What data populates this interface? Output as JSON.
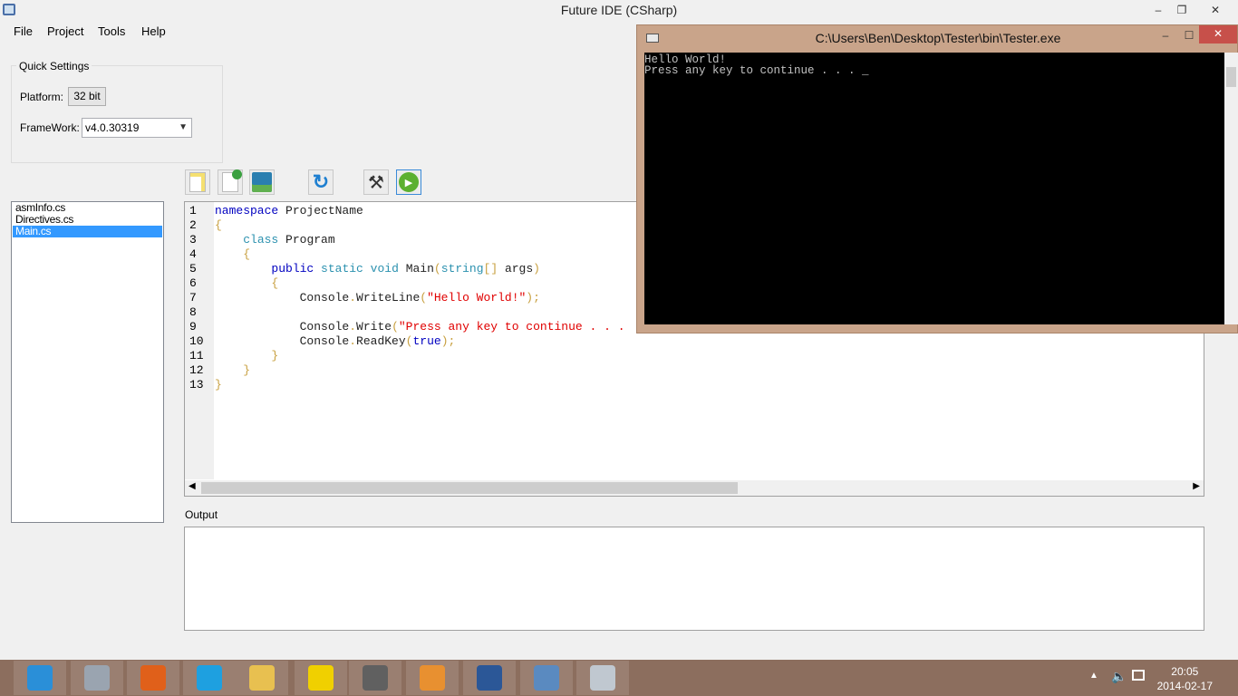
{
  "window": {
    "title": "Future IDE (CSharp)",
    "minimize": "–",
    "restore": "❐",
    "close": "✕"
  },
  "menu": [
    "File",
    "Project",
    "Tools",
    "Help"
  ],
  "quick_settings": {
    "title": "Quick Settings",
    "platform_label": "Platform:",
    "platform_value": "32 bit",
    "framework_label": "FrameWork:",
    "framework_value": "v4.0.30319"
  },
  "toolbar": [
    "new-file-icon",
    "add-file-icon",
    "save-icon",
    "refresh-icon",
    "build-tools-icon",
    "run-icon"
  ],
  "files": [
    {
      "name": "asmInfo.cs",
      "selected": false
    },
    {
      "name": "Directives.cs",
      "selected": false
    },
    {
      "name": "Main.cs",
      "selected": true
    }
  ],
  "editor": {
    "line_numbers": [
      "1",
      "2",
      "3",
      "4",
      "5",
      "6",
      "7",
      "8",
      "9",
      "10",
      "11",
      "12",
      "13"
    ],
    "lines": [
      [
        [
          "kw",
          "namespace"
        ],
        [
          "id",
          " ProjectName"
        ]
      ],
      [
        [
          "pu",
          "{"
        ]
      ],
      [
        [
          "id",
          "    "
        ],
        [
          "ty",
          "class"
        ],
        [
          "id",
          " Program"
        ]
      ],
      [
        [
          "pu",
          "    {"
        ]
      ],
      [
        [
          "id",
          "        "
        ],
        [
          "kw",
          "public"
        ],
        [
          "id",
          " "
        ],
        [
          "ty",
          "static"
        ],
        [
          "id",
          " "
        ],
        [
          "ty",
          "void"
        ],
        [
          "id",
          " Main"
        ],
        [
          "pu",
          "("
        ],
        [
          "ty",
          "string"
        ],
        [
          "pu",
          "[]"
        ],
        [
          "id",
          " args"
        ],
        [
          "pu",
          ")"
        ]
      ],
      [
        [
          "pu",
          "        {"
        ]
      ],
      [
        [
          "id",
          "            Console"
        ],
        [
          "pu",
          "."
        ],
        [
          "id",
          "WriteLine"
        ],
        [
          "pu",
          "("
        ],
        [
          "st",
          "\"Hello World!\""
        ],
        [
          "pu",
          ");"
        ]
      ],
      [],
      [
        [
          "id",
          "            Console"
        ],
        [
          "pu",
          "."
        ],
        [
          "id",
          "Write"
        ],
        [
          "pu",
          "("
        ],
        [
          "st",
          "\"Press any key to continue . . ."
        ]
      ],
      [
        [
          "id",
          "            Console"
        ],
        [
          "pu",
          "."
        ],
        [
          "id",
          "ReadKey"
        ],
        [
          "pu",
          "("
        ],
        [
          "kw",
          "true"
        ],
        [
          "pu",
          ");"
        ]
      ],
      [
        [
          "pu",
          "        }"
        ]
      ],
      [
        [
          "pu",
          "    }"
        ]
      ],
      [
        [
          "pu",
          "}"
        ]
      ]
    ]
  },
  "output": {
    "label": "Output"
  },
  "console": {
    "title": "C:\\Users\\Ben\\Desktop\\Tester\\bin\\Tester.exe",
    "lines": [
      "Hello World!",
      "Press any key to continue . . . _"
    ]
  },
  "taskbar": {
    "apps": [
      {
        "icon": "internet-explorer-icon",
        "color": "#2a8fd8"
      },
      {
        "icon": "calculator-icon",
        "color": "#9aa4b0"
      },
      {
        "icon": "firefox-icon",
        "color": "#e0601a"
      },
      {
        "icon": "skype-icon",
        "color": "#1ea0e0"
      },
      {
        "icon": "file-explorer-icon",
        "color": "#e8c050"
      },
      {
        "icon": "striped-app-icon",
        "color": "#f0d000"
      },
      {
        "icon": "sharpdevelop-icon",
        "color": "#606060"
      },
      {
        "icon": "media-player-icon",
        "color": "#e89030"
      },
      {
        "icon": "word-icon",
        "color": "#2b5797"
      },
      {
        "icon": "window-app-icon",
        "color": "#5a8ac0"
      },
      {
        "icon": "console-app-icon",
        "color": "#c0c8d0"
      }
    ],
    "time": "20:05",
    "date": "2014-02-17"
  },
  "colors": {
    "selection": "#3399ff",
    "taskbar": "#8c6e5e",
    "console_border": "#c9a48a"
  }
}
